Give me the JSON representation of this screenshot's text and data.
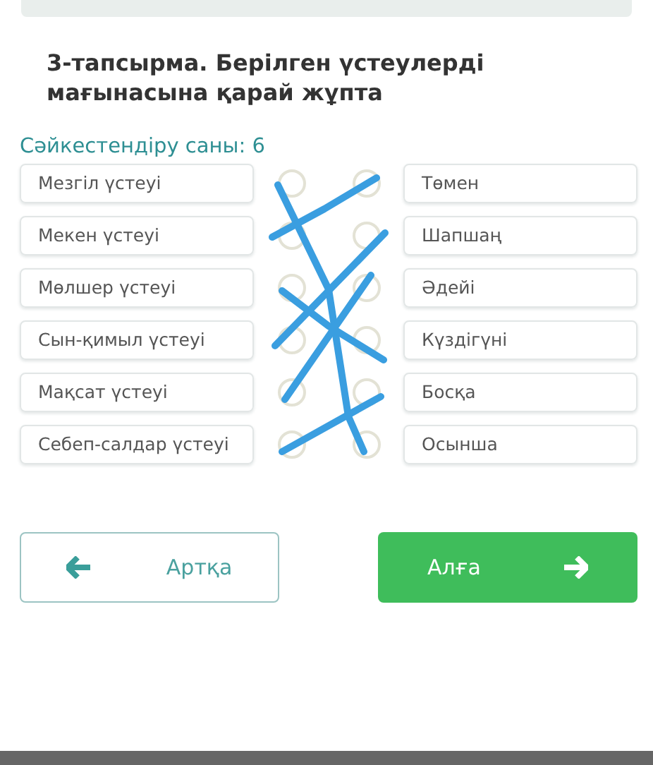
{
  "task_title": "3-тапсырма. Берілген үстеулерді мағынасына қарай жұпта",
  "match_count": "Сәйкестендіру саны: 6",
  "left_items": [
    "Мезгіл үстеуі",
    "Мекен үстеуі",
    "Мөлшер үстеуі",
    "Сын-қимыл үстеуі",
    "Мақсат үстеуі",
    "Себеп-салдар үстеуі"
  ],
  "right_items": [
    "Төмен",
    "Шапшаң",
    "Әдейі",
    "Күздігүні",
    "Босқа",
    "Осынша"
  ],
  "buttons": [
    {
      "kind": "back",
      "label": "Артқа"
    },
    {
      "kind": "next",
      "label": "Алға"
    }
  ]
}
